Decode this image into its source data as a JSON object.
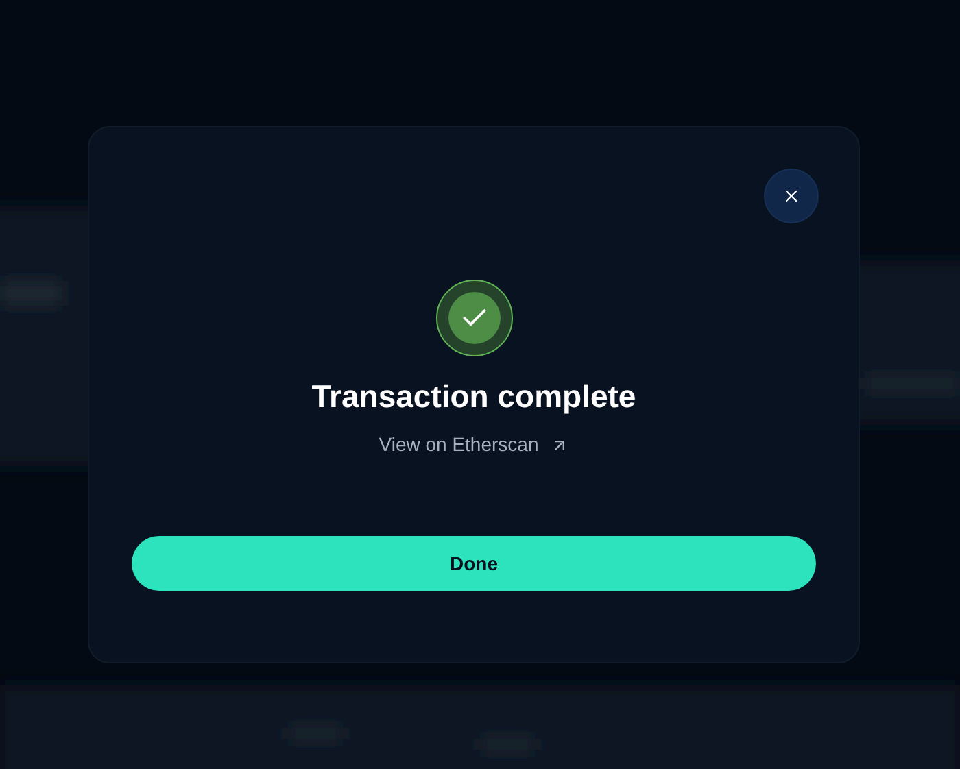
{
  "modal": {
    "title": "Transaction complete",
    "link": "View on Etherscan",
    "button": "Done"
  }
}
